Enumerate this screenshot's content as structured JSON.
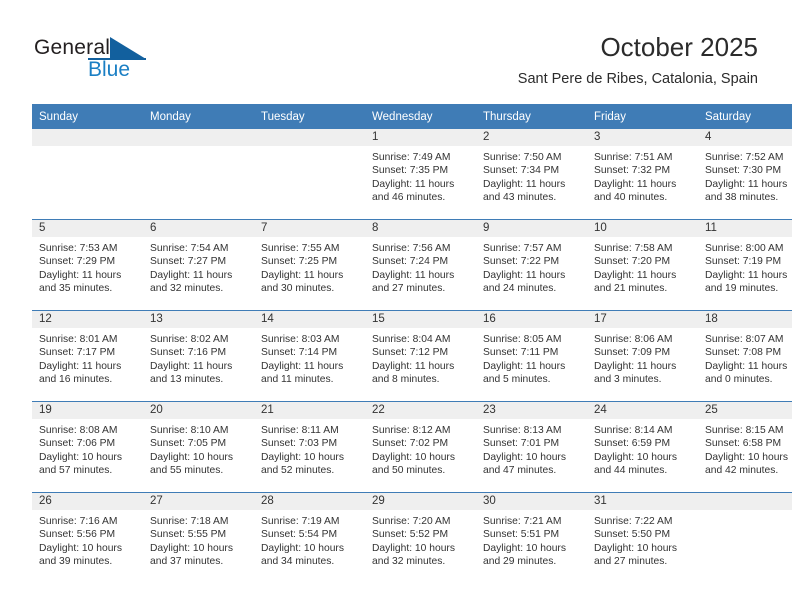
{
  "brand": {
    "name_part1": "General",
    "name_part2": "Blue",
    "triangle_color": "#12609e",
    "blue_text_color": "#1b7fc4"
  },
  "header": {
    "title": "October 2025",
    "subtitle": "Sant Pere de Ribes, Catalonia, Spain"
  },
  "colors": {
    "header_row_bg": "#3f7cb6",
    "header_row_text": "#ffffff",
    "daynum_band_bg": "#efefef",
    "cell_bg": "#ffffff",
    "grid_line": "#3f7cb6",
    "body_text": "#333333"
  },
  "weekdays": [
    "Sunday",
    "Monday",
    "Tuesday",
    "Wednesday",
    "Thursday",
    "Friday",
    "Saturday"
  ],
  "weeks": [
    [
      {
        "day": "",
        "empty": true,
        "sunrise": "",
        "sunset": "",
        "daylight_line1": "",
        "daylight_line2": ""
      },
      {
        "day": "",
        "empty": true,
        "sunrise": "",
        "sunset": "",
        "daylight_line1": "",
        "daylight_line2": ""
      },
      {
        "day": "",
        "empty": true,
        "sunrise": "",
        "sunset": "",
        "daylight_line1": "",
        "daylight_line2": ""
      },
      {
        "day": "1",
        "empty": false,
        "sunrise": "Sunrise: 7:49 AM",
        "sunset": "Sunset: 7:35 PM",
        "daylight_line1": "Daylight: 11 hours",
        "daylight_line2": "and 46 minutes."
      },
      {
        "day": "2",
        "empty": false,
        "sunrise": "Sunrise: 7:50 AM",
        "sunset": "Sunset: 7:34 PM",
        "daylight_line1": "Daylight: 11 hours",
        "daylight_line2": "and 43 minutes."
      },
      {
        "day": "3",
        "empty": false,
        "sunrise": "Sunrise: 7:51 AM",
        "sunset": "Sunset: 7:32 PM",
        "daylight_line1": "Daylight: 11 hours",
        "daylight_line2": "and 40 minutes."
      },
      {
        "day": "4",
        "empty": false,
        "sunrise": "Sunrise: 7:52 AM",
        "sunset": "Sunset: 7:30 PM",
        "daylight_line1": "Daylight: 11 hours",
        "daylight_line2": "and 38 minutes."
      }
    ],
    [
      {
        "day": "5",
        "empty": false,
        "sunrise": "Sunrise: 7:53 AM",
        "sunset": "Sunset: 7:29 PM",
        "daylight_line1": "Daylight: 11 hours",
        "daylight_line2": "and 35 minutes."
      },
      {
        "day": "6",
        "empty": false,
        "sunrise": "Sunrise: 7:54 AM",
        "sunset": "Sunset: 7:27 PM",
        "daylight_line1": "Daylight: 11 hours",
        "daylight_line2": "and 32 minutes."
      },
      {
        "day": "7",
        "empty": false,
        "sunrise": "Sunrise: 7:55 AM",
        "sunset": "Sunset: 7:25 PM",
        "daylight_line1": "Daylight: 11 hours",
        "daylight_line2": "and 30 minutes."
      },
      {
        "day": "8",
        "empty": false,
        "sunrise": "Sunrise: 7:56 AM",
        "sunset": "Sunset: 7:24 PM",
        "daylight_line1": "Daylight: 11 hours",
        "daylight_line2": "and 27 minutes."
      },
      {
        "day": "9",
        "empty": false,
        "sunrise": "Sunrise: 7:57 AM",
        "sunset": "Sunset: 7:22 PM",
        "daylight_line1": "Daylight: 11 hours",
        "daylight_line2": "and 24 minutes."
      },
      {
        "day": "10",
        "empty": false,
        "sunrise": "Sunrise: 7:58 AM",
        "sunset": "Sunset: 7:20 PM",
        "daylight_line1": "Daylight: 11 hours",
        "daylight_line2": "and 21 minutes."
      },
      {
        "day": "11",
        "empty": false,
        "sunrise": "Sunrise: 8:00 AM",
        "sunset": "Sunset: 7:19 PM",
        "daylight_line1": "Daylight: 11 hours",
        "daylight_line2": "and 19 minutes."
      }
    ],
    [
      {
        "day": "12",
        "empty": false,
        "sunrise": "Sunrise: 8:01 AM",
        "sunset": "Sunset: 7:17 PM",
        "daylight_line1": "Daylight: 11 hours",
        "daylight_line2": "and 16 minutes."
      },
      {
        "day": "13",
        "empty": false,
        "sunrise": "Sunrise: 8:02 AM",
        "sunset": "Sunset: 7:16 PM",
        "daylight_line1": "Daylight: 11 hours",
        "daylight_line2": "and 13 minutes."
      },
      {
        "day": "14",
        "empty": false,
        "sunrise": "Sunrise: 8:03 AM",
        "sunset": "Sunset: 7:14 PM",
        "daylight_line1": "Daylight: 11 hours",
        "daylight_line2": "and 11 minutes."
      },
      {
        "day": "15",
        "empty": false,
        "sunrise": "Sunrise: 8:04 AM",
        "sunset": "Sunset: 7:12 PM",
        "daylight_line1": "Daylight: 11 hours",
        "daylight_line2": "and 8 minutes."
      },
      {
        "day": "16",
        "empty": false,
        "sunrise": "Sunrise: 8:05 AM",
        "sunset": "Sunset: 7:11 PM",
        "daylight_line1": "Daylight: 11 hours",
        "daylight_line2": "and 5 minutes."
      },
      {
        "day": "17",
        "empty": false,
        "sunrise": "Sunrise: 8:06 AM",
        "sunset": "Sunset: 7:09 PM",
        "daylight_line1": "Daylight: 11 hours",
        "daylight_line2": "and 3 minutes."
      },
      {
        "day": "18",
        "empty": false,
        "sunrise": "Sunrise: 8:07 AM",
        "sunset": "Sunset: 7:08 PM",
        "daylight_line1": "Daylight: 11 hours",
        "daylight_line2": "and 0 minutes."
      }
    ],
    [
      {
        "day": "19",
        "empty": false,
        "sunrise": "Sunrise: 8:08 AM",
        "sunset": "Sunset: 7:06 PM",
        "daylight_line1": "Daylight: 10 hours",
        "daylight_line2": "and 57 minutes."
      },
      {
        "day": "20",
        "empty": false,
        "sunrise": "Sunrise: 8:10 AM",
        "sunset": "Sunset: 7:05 PM",
        "daylight_line1": "Daylight: 10 hours",
        "daylight_line2": "and 55 minutes."
      },
      {
        "day": "21",
        "empty": false,
        "sunrise": "Sunrise: 8:11 AM",
        "sunset": "Sunset: 7:03 PM",
        "daylight_line1": "Daylight: 10 hours",
        "daylight_line2": "and 52 minutes."
      },
      {
        "day": "22",
        "empty": false,
        "sunrise": "Sunrise: 8:12 AM",
        "sunset": "Sunset: 7:02 PM",
        "daylight_line1": "Daylight: 10 hours",
        "daylight_line2": "and 50 minutes."
      },
      {
        "day": "23",
        "empty": false,
        "sunrise": "Sunrise: 8:13 AM",
        "sunset": "Sunset: 7:01 PM",
        "daylight_line1": "Daylight: 10 hours",
        "daylight_line2": "and 47 minutes."
      },
      {
        "day": "24",
        "empty": false,
        "sunrise": "Sunrise: 8:14 AM",
        "sunset": "Sunset: 6:59 PM",
        "daylight_line1": "Daylight: 10 hours",
        "daylight_line2": "and 44 minutes."
      },
      {
        "day": "25",
        "empty": false,
        "sunrise": "Sunrise: 8:15 AM",
        "sunset": "Sunset: 6:58 PM",
        "daylight_line1": "Daylight: 10 hours",
        "daylight_line2": "and 42 minutes."
      }
    ],
    [
      {
        "day": "26",
        "empty": false,
        "sunrise": "Sunrise: 7:16 AM",
        "sunset": "Sunset: 5:56 PM",
        "daylight_line1": "Daylight: 10 hours",
        "daylight_line2": "and 39 minutes."
      },
      {
        "day": "27",
        "empty": false,
        "sunrise": "Sunrise: 7:18 AM",
        "sunset": "Sunset: 5:55 PM",
        "daylight_line1": "Daylight: 10 hours",
        "daylight_line2": "and 37 minutes."
      },
      {
        "day": "28",
        "empty": false,
        "sunrise": "Sunrise: 7:19 AM",
        "sunset": "Sunset: 5:54 PM",
        "daylight_line1": "Daylight: 10 hours",
        "daylight_line2": "and 34 minutes."
      },
      {
        "day": "29",
        "empty": false,
        "sunrise": "Sunrise: 7:20 AM",
        "sunset": "Sunset: 5:52 PM",
        "daylight_line1": "Daylight: 10 hours",
        "daylight_line2": "and 32 minutes."
      },
      {
        "day": "30",
        "empty": false,
        "sunrise": "Sunrise: 7:21 AM",
        "sunset": "Sunset: 5:51 PM",
        "daylight_line1": "Daylight: 10 hours",
        "daylight_line2": "and 29 minutes."
      },
      {
        "day": "31",
        "empty": false,
        "sunrise": "Sunrise: 7:22 AM",
        "sunset": "Sunset: 5:50 PM",
        "daylight_line1": "Daylight: 10 hours",
        "daylight_line2": "and 27 minutes."
      },
      {
        "day": "",
        "empty": true,
        "sunrise": "",
        "sunset": "",
        "daylight_line1": "",
        "daylight_line2": ""
      }
    ]
  ]
}
